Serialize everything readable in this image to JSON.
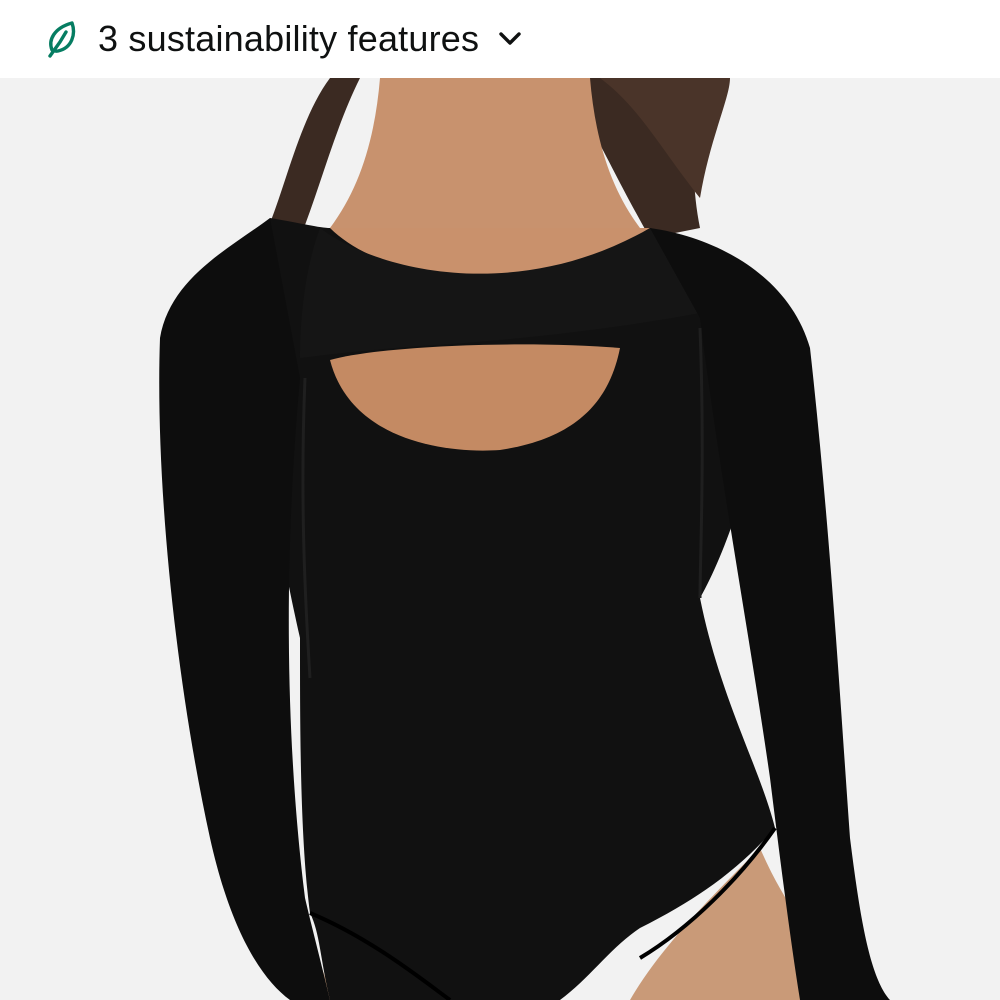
{
  "sustainability": {
    "count_label": "3 sustainability features",
    "icon": "leaf-icon",
    "expand_icon": "chevron-down-icon",
    "accent_color": "#067d62"
  },
  "product_image": {
    "subject": "black long-sleeve asymmetric cutout bodysuit",
    "background_color": "#f2f2f2",
    "garment_color": "#111111"
  }
}
